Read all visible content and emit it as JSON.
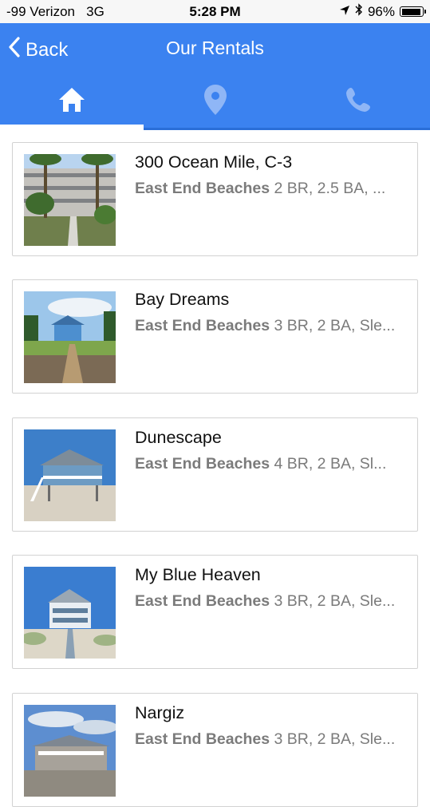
{
  "status_bar": {
    "carrier": "-99 Verizon",
    "network": "3G",
    "time": "5:28 PM",
    "battery_percent": "96%",
    "battery_level": 0.96
  },
  "nav": {
    "back_label": "Back",
    "title": "Our Rentals",
    "tabs": [
      {
        "icon": "home-icon",
        "active": true
      },
      {
        "icon": "map-pin-icon",
        "active": false
      },
      {
        "icon": "phone-icon",
        "active": false
      }
    ],
    "accent_color": "#3b82f0"
  },
  "rentals": [
    {
      "name": "300 Ocean Mile, C-3",
      "area": "East End Beaches",
      "details": "2 BR, 2.5 BA, ..."
    },
    {
      "name": "Bay Dreams",
      "area": "East End Beaches",
      "details": "3 BR, 2 BA, Sle..."
    },
    {
      "name": "Dunescape",
      "area": "East End Beaches",
      "details": "4 BR, 2 BA, Sl..."
    },
    {
      "name": "My Blue Heaven",
      "area": "East End Beaches",
      "details": "3 BR, 2 BA, Sle..."
    },
    {
      "name": "Nargiz",
      "area": "East End Beaches",
      "details": "3 BR, 2 BA, Sle..."
    }
  ]
}
